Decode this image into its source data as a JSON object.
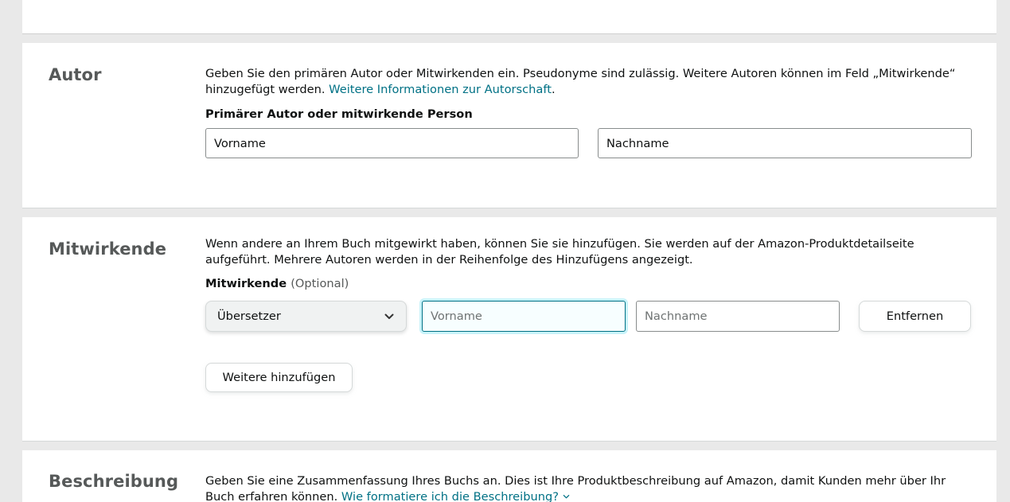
{
  "autor": {
    "title": "Autor",
    "description": "Geben Sie den primären Autor oder Mitwirkenden ein. Pseudonyme sind zulässig. Weitere Autoren können im Feld „Mitwirkende“ hinzugefügt werden.",
    "link": "Weitere Informationen zur Autorschaft",
    "link_suffix": ".",
    "field_label": "Primärer Autor oder mitwirkende Person",
    "first_name_value": "Vorname",
    "last_name_value": "Nachname"
  },
  "mitwirkende": {
    "title": "Mitwirkende",
    "description": "Wenn andere an Ihrem Buch mitgewirkt haben, können Sie sie hinzufügen. Sie werden auf der Amazon-Produktdetailseite aufgeführt. Mehrere Autoren werden in der Reihenfolge des Hinzufügens angezeigt.",
    "field_label": "Mitwirkende",
    "field_label_optional": "(Optional)",
    "role_selected": "Übersetzer",
    "first_name_placeholder": "Vorname",
    "last_name_placeholder": "Nachname",
    "remove_label": "Entfernen",
    "add_more_label": "Weitere hinzufügen"
  },
  "beschreibung": {
    "title": "Beschreibung",
    "description": "Geben Sie eine Zusammenfassung Ihres Buchs an. Dies ist Ihre Produktbeschreibung auf Amazon, damit Kunden mehr über Ihr Buch erfahren können.",
    "link": "Wie formatiere ich die Beschreibung?"
  },
  "icons": {
    "select_chevron": "chevron-down-icon",
    "link_chevron": "chevron-down-icon"
  },
  "colors": {
    "link": "#007185",
    "focus_ring": "#c8f3fa",
    "background": "#e9e9e9"
  }
}
